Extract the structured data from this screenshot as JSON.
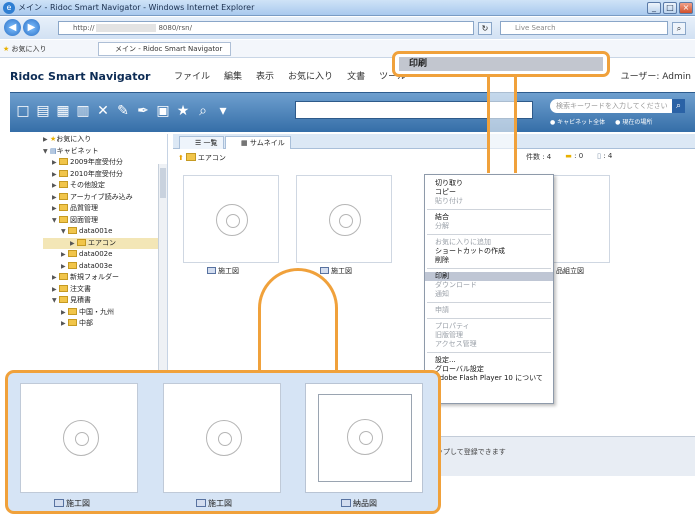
{
  "window": {
    "title": "メイン - Ridoc Smart Navigator - Windows Internet Explorer",
    "min": "_",
    "max": "□",
    "close": "×"
  },
  "browser": {
    "back": "◀",
    "forward": "▶",
    "url": "http://",
    "url_tail": "8080/rsn/",
    "live_search_placeholder": "Live Search",
    "favorites_label": "お気に入り",
    "tab_label": "メイン - Ridoc Smart Navigator"
  },
  "app": {
    "logo": "Ridoc Smart Navigator",
    "menu": [
      "ファイル",
      "編集",
      "表示",
      "お気に入り",
      "文書",
      "ツール"
    ],
    "user": "ユーザー: Admin",
    "search_keyword_placeholder": "検索キーワードを入力してください",
    "radio_cabinet": "キャビネット全体",
    "radio_current": "現在の場所"
  },
  "tree": {
    "favorites": "お気に入り",
    "cabinet": "キャビネット",
    "items": [
      {
        "label": "2009年度受付分",
        "indent": 1,
        "open": false
      },
      {
        "label": "2010年度受付分",
        "indent": 1,
        "open": false
      },
      {
        "label": "その他設定",
        "indent": 1,
        "open": false
      },
      {
        "label": "アーカイブ読み込み",
        "indent": 1,
        "open": false
      },
      {
        "label": "品質管理",
        "indent": 1,
        "open": false
      },
      {
        "label": "図面管理",
        "indent": 1,
        "open": true
      },
      {
        "label": "data001e",
        "indent": 2,
        "open": true
      },
      {
        "label": "エアコン",
        "indent": 3,
        "open": false,
        "selected": true
      },
      {
        "label": "data002e",
        "indent": 2,
        "open": false
      },
      {
        "label": "data003e",
        "indent": 2,
        "open": false
      },
      {
        "label": "新規フォルダー",
        "indent": 1,
        "open": false
      },
      {
        "label": "注文書",
        "indent": 1,
        "open": false
      },
      {
        "label": "見積書",
        "indent": 1,
        "open": true
      },
      {
        "label": "中国・九州",
        "indent": 2,
        "open": false
      },
      {
        "label": "中部",
        "indent": 2,
        "open": false
      }
    ]
  },
  "content": {
    "tab_list": "一覧",
    "tab_thumb": "サムネイル",
    "crumb": "エアコン",
    "count_docs": "件数 : 4",
    "count_folders": "0",
    "count_files": "4",
    "thumbs": [
      {
        "label": "施工図"
      },
      {
        "label": "施工図"
      }
    ],
    "side_label": "品組立図",
    "hint": "ップして登録できます"
  },
  "context_menu": {
    "items": [
      {
        "label": "切り取り",
        "dim": false
      },
      {
        "label": "コピー",
        "dim": false
      },
      {
        "label": "貼り付け",
        "dim": true
      },
      {
        "sep": true
      },
      {
        "label": "結合",
        "dim": false
      },
      {
        "label": "分解",
        "dim": true
      },
      {
        "sep": true
      },
      {
        "label": "お気に入りに追加",
        "dim": true
      },
      {
        "label": "ショートカットの作成",
        "dim": false
      },
      {
        "label": "削除",
        "dim": false
      },
      {
        "sep": true
      },
      {
        "label": "印刷",
        "dim": false,
        "hl": true
      },
      {
        "label": "ダウンロード",
        "dim": true
      },
      {
        "label": "通知",
        "dim": true
      },
      {
        "sep": true
      },
      {
        "label": "申請",
        "dim": true
      },
      {
        "sep": true
      },
      {
        "label": "プロパティ",
        "dim": true
      },
      {
        "label": "旧版管理",
        "dim": true
      },
      {
        "label": "アクセス管理",
        "dim": true
      },
      {
        "sep": true
      },
      {
        "label": "設定...",
        "dim": false
      },
      {
        "label": "グローバル設定",
        "dim": false
      },
      {
        "label": "Adobe Flash Player 10 について",
        "dim": false
      }
    ]
  },
  "callout": {
    "print_label": "印刷"
  },
  "zoom": {
    "cards": [
      {
        "label": "施工図"
      },
      {
        "label": "施工図"
      },
      {
        "label": "納品図"
      }
    ]
  },
  "colors": {
    "accent_orange": "#f0a13b",
    "toolbar_blue": "#356ea8",
    "highlight_gray": "#c2c6cf"
  }
}
